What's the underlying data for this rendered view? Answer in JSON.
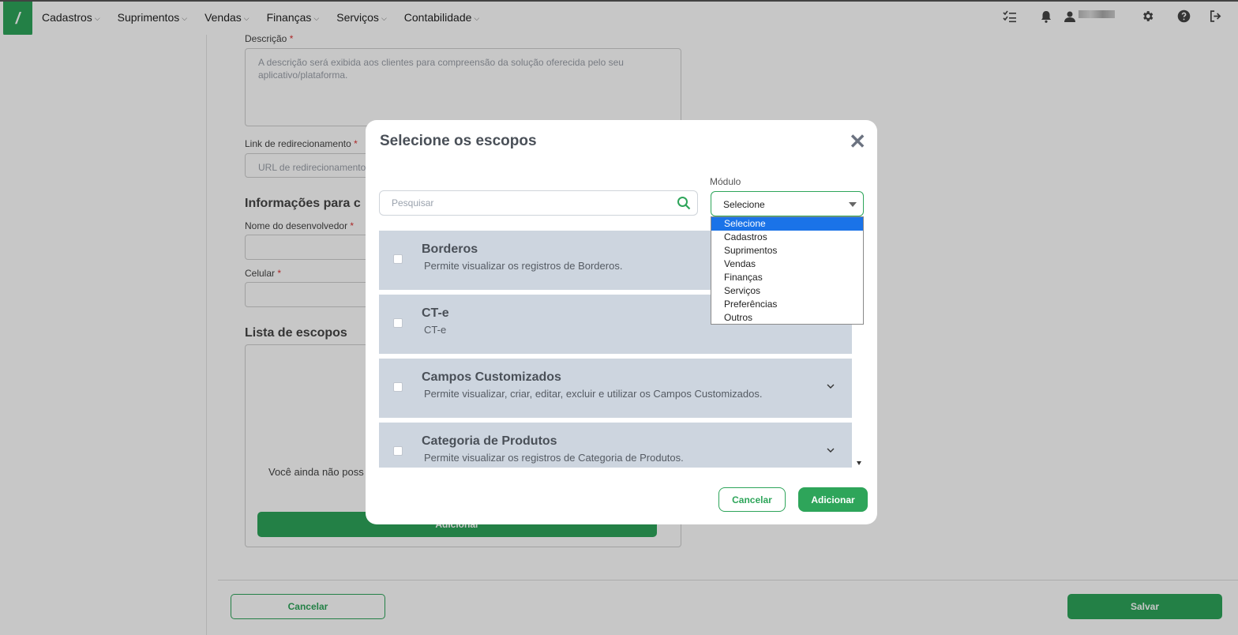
{
  "nav": {
    "items": [
      "Cadastros",
      "Suprimentos",
      "Vendas",
      "Finanças",
      "Serviços",
      "Contabilidade"
    ],
    "icons": [
      "checklist-icon",
      "bell-icon",
      "user-icon",
      "gear-icon",
      "help-icon",
      "logout-icon"
    ]
  },
  "form": {
    "descricao_label": "Descrição",
    "descricao_placeholder": "A descrição será exibida aos clientes para compreensão da solução oferecida pelo seu aplicativo/plataforma.",
    "link_label": "Link de redirecionamento",
    "link_placeholder": "URL de redirecionamento",
    "info_title": "Informações para c",
    "dev_label": "Nome do desenvolvedor",
    "celular_label": "Celular",
    "escopos_title": "Lista de escopos",
    "empty_text": "Você ainda não poss",
    "add_label": "Adicionar",
    "required_mark": "*"
  },
  "footer": {
    "cancel_label": "Cancelar",
    "save_label": "Salvar"
  },
  "modal": {
    "title": "Selecione os escopos",
    "close_symbol": "✕",
    "search_placeholder": "Pesquisar",
    "modulo_label": "Módulo",
    "modulo_value": "Selecione",
    "scopes": [
      {
        "title": "Borderos",
        "desc": "Permite visualizar os registros de Borderos."
      },
      {
        "title": "CT-e",
        "desc": "CT-e"
      },
      {
        "title": "Campos Customizados",
        "desc": "Permite visualizar, criar, editar, excluir e utilizar os Campos Customizados."
      },
      {
        "title": "Categoria de Produtos",
        "desc": "Permite visualizar os registros de Categoria de Produtos."
      }
    ],
    "cancel_label": "Cancelar",
    "add_label": "Adicionar",
    "dropdown_options": [
      "Selecione",
      "Cadastros",
      "Suprimentos",
      "Vendas",
      "Finanças",
      "Serviços",
      "Preferências",
      "Outros"
    ]
  },
  "colors": {
    "brand_green": "#2ea55a",
    "row_bg": "#cdd5df",
    "selected_option": "#1a73e8"
  }
}
